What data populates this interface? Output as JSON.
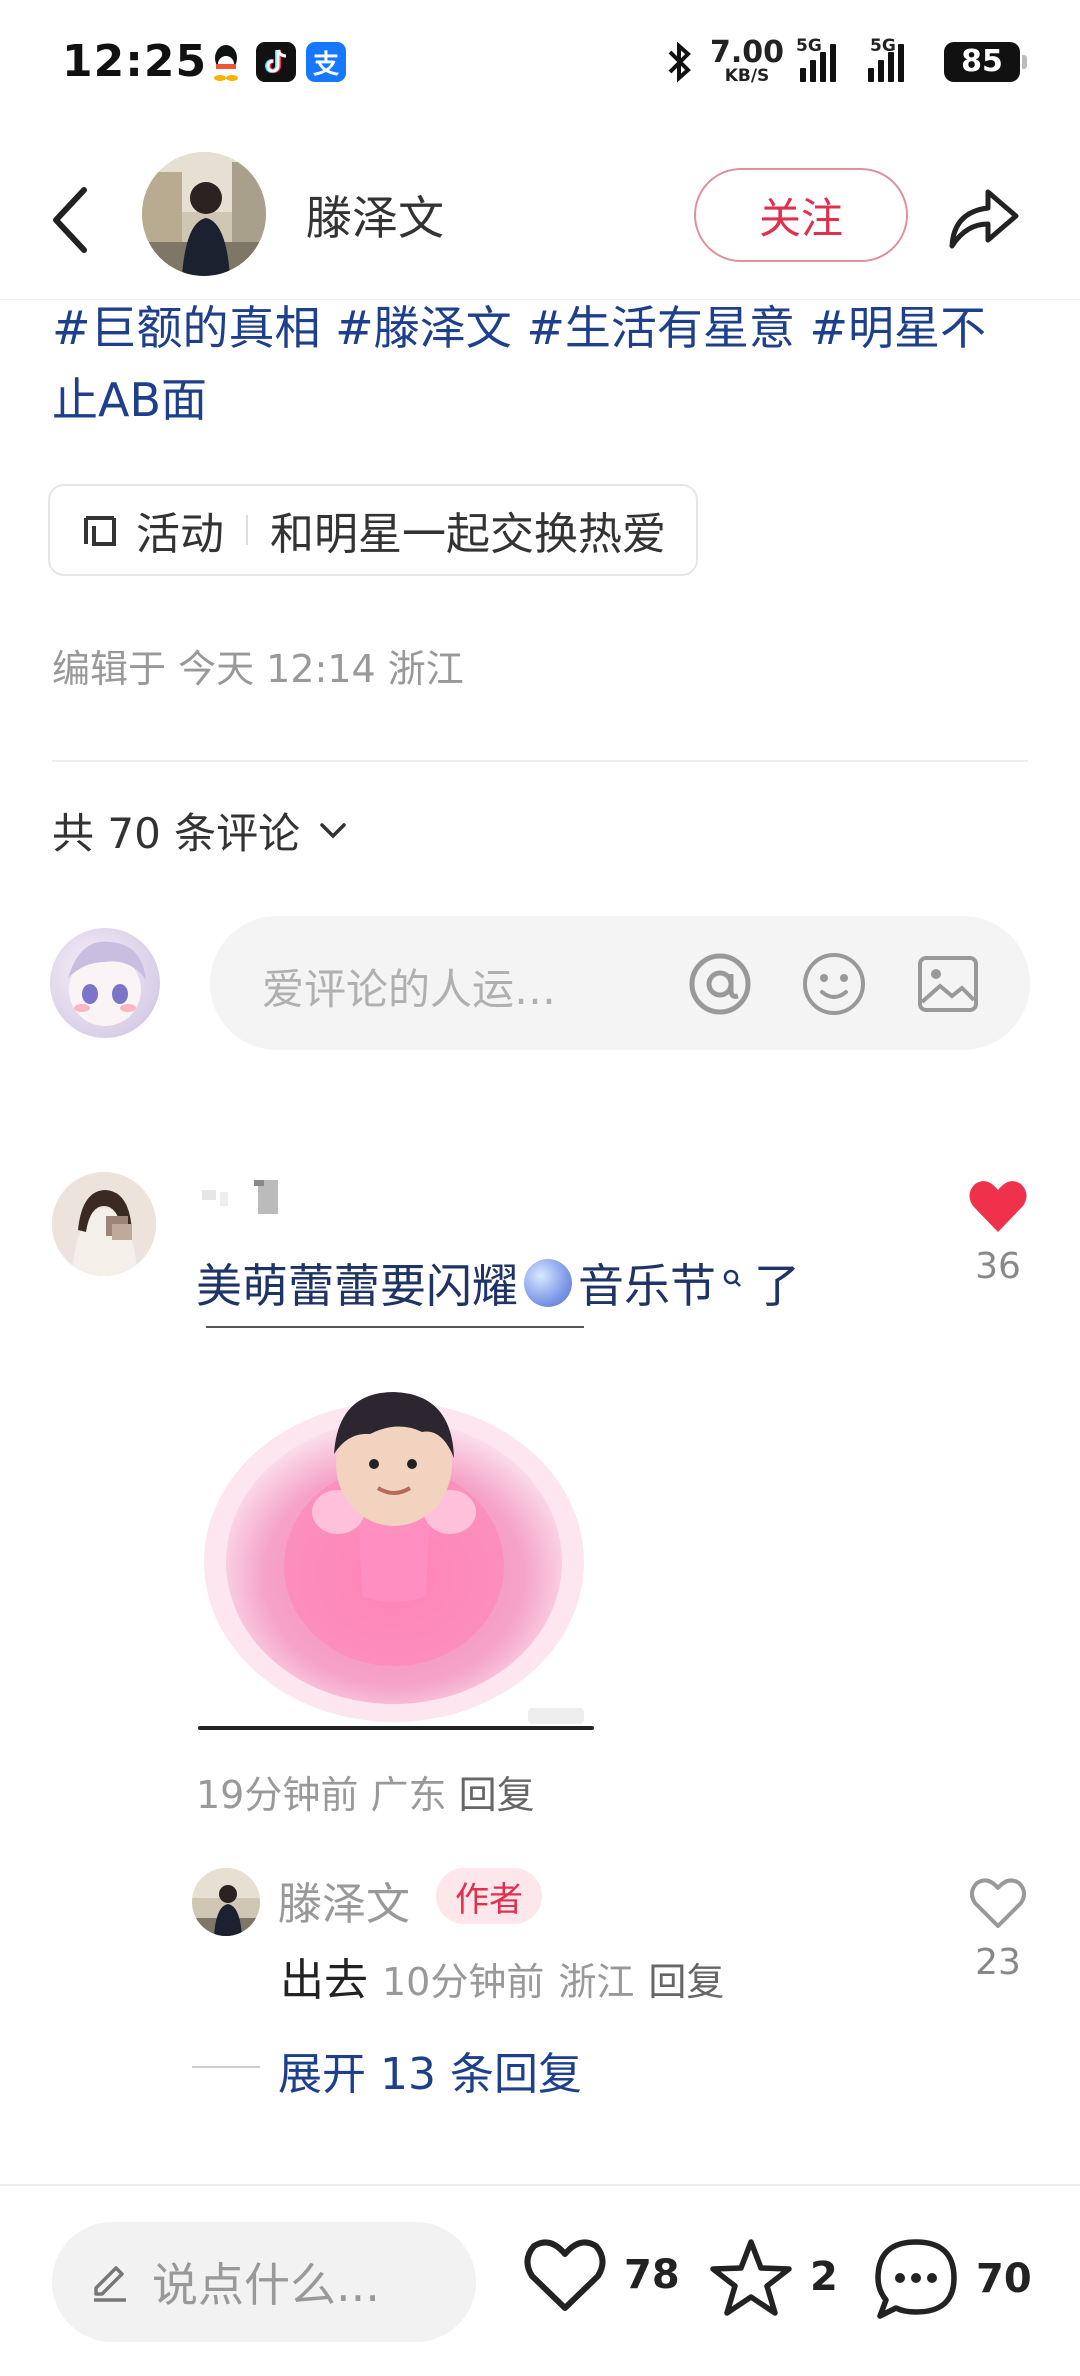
{
  "status_bar": {
    "time": "12:25",
    "speed_value": "7.00",
    "speed_unit": "KB/S",
    "net1": "5G",
    "net2": "5G",
    "battery": "85",
    "apps": [
      "qq-icon",
      "tiktok-icon",
      "alipay-icon"
    ]
  },
  "header": {
    "author_name": "滕泽文",
    "follow_label": "关注"
  },
  "post": {
    "tags_text": "#巨额的真相 #滕泽文 #生活有星意 #明星不止AB面",
    "activity_label": "活动",
    "activity_title": "和明星一起交换热爱",
    "edited_info": "编辑于 今天 12:14 浙江"
  },
  "comments_section": {
    "count_label": "共 70 条评论",
    "input_placeholder": "爱评论的人运…"
  },
  "comment": {
    "text_before": "美萌蕾蕾要闪耀",
    "text_after": "音乐节",
    "text_tail": "了",
    "time": "19分钟前",
    "location": "广东",
    "reply_label": "回复",
    "like_count": "36"
  },
  "reply": {
    "author": "滕泽文",
    "badge": "作者",
    "text": "出去",
    "time": "10分钟前",
    "location": "浙江",
    "reply_label": "回复",
    "like_count": "23",
    "expand_label": "展开 13 条回复"
  },
  "bottom_bar": {
    "input_placeholder": "说点什么...",
    "likes": "78",
    "stars": "2",
    "comments": "70"
  },
  "colors": {
    "accent_red": "#e03050",
    "tag_blue": "#1e3f8c",
    "heart_red": "#f0314b"
  }
}
